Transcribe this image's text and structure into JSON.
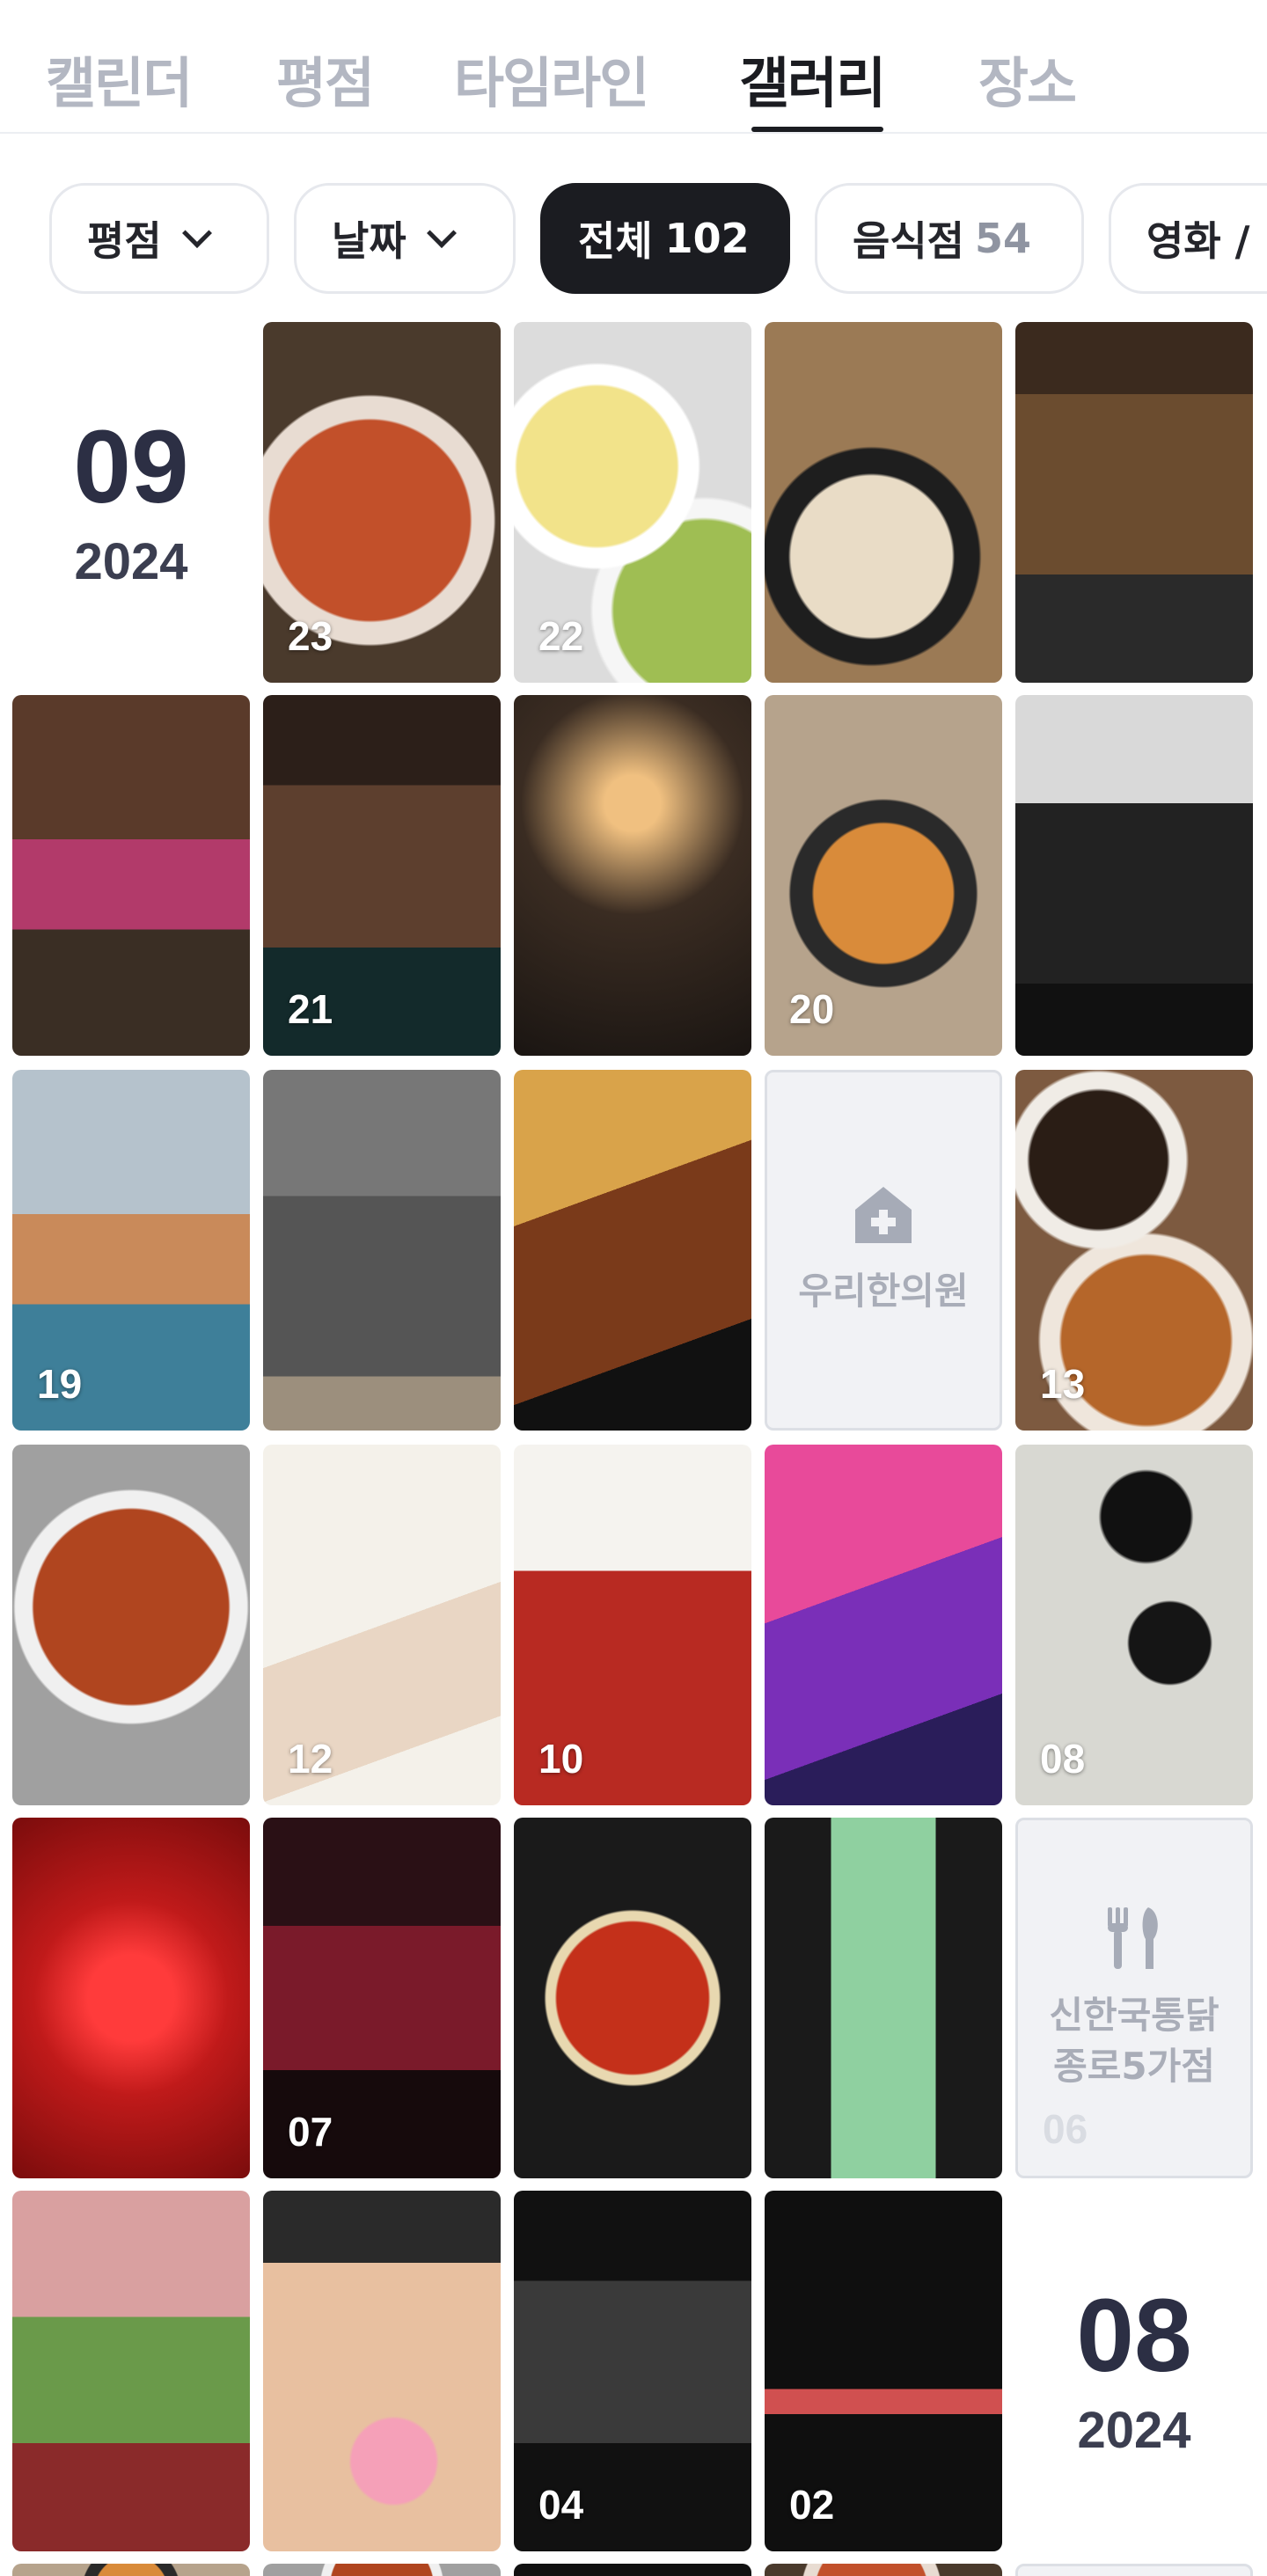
{
  "tabs": [
    {
      "label": "캘린더"
    },
    {
      "label": "평점"
    },
    {
      "label": "타임라인"
    },
    {
      "label": "갤러리"
    },
    {
      "label": "장소"
    }
  ],
  "active_tab": "갤러리",
  "filters": {
    "rating": {
      "label": "평점"
    },
    "date": {
      "label": "날짜"
    },
    "all": {
      "label": "전체",
      "count": "102"
    },
    "restaurant": {
      "label": "음식점",
      "count": "54"
    },
    "movie": {
      "label": "영화 /"
    }
  },
  "months": [
    {
      "month": "09",
      "year": "2024"
    },
    {
      "month": "08",
      "year": "2024"
    }
  ],
  "tiles": {
    "t23": "23",
    "t22": "22",
    "t21": "21",
    "t20": "20",
    "t19": "19",
    "t13": "13",
    "t12": "12",
    "t10": "10",
    "t08": "08",
    "t07": "07",
    "t06": "06",
    "t04": "04",
    "t02": "02"
  },
  "places": {
    "clinic": {
      "name": "우리한의원"
    },
    "chicken": {
      "name": "신한국통닭\n종로5가점"
    }
  },
  "icon_names": {
    "clinic": "hospital-house-icon",
    "restaurant": "fork-knife-icon",
    "chevron": "chevron-down-icon"
  },
  "colors": {
    "active_tab": "#1b1c21",
    "inactive_tab": "#b3b7c2",
    "chip_dark_bg": "#1b1c21",
    "month_text": "#2c2f44"
  }
}
